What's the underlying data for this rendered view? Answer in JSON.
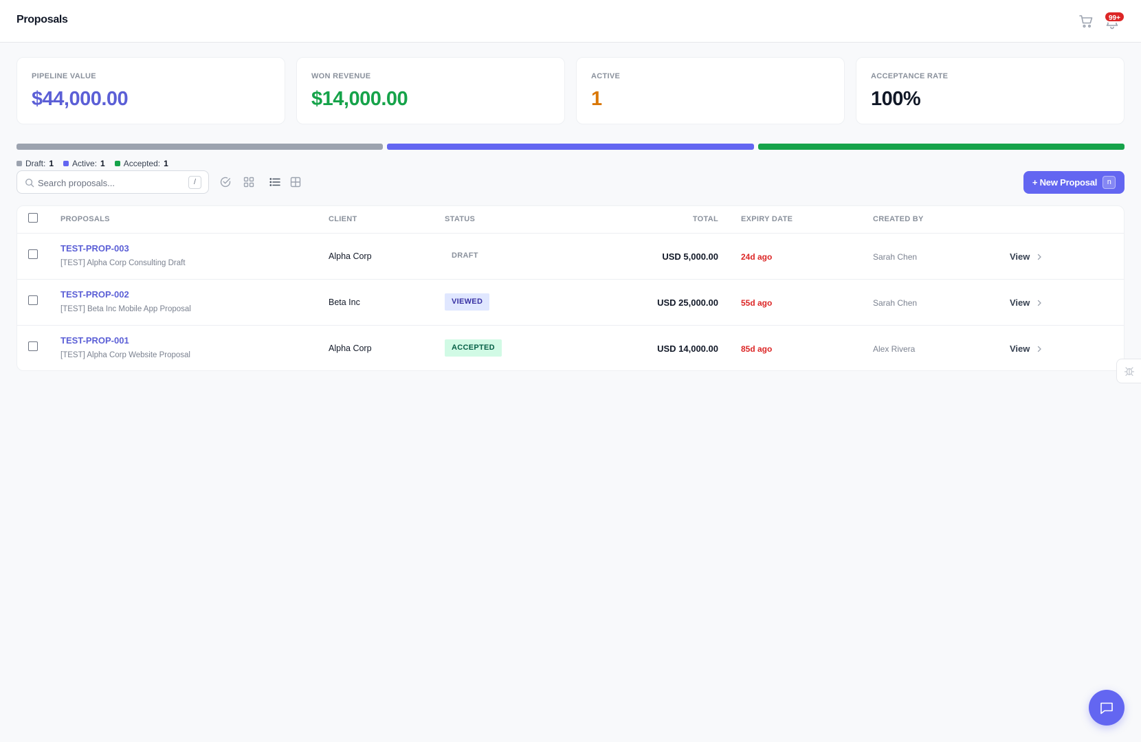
{
  "header": {
    "title": "Proposals",
    "notification_count": "99+"
  },
  "stats": [
    {
      "label": "PIPELINE VALUE",
      "value": "$44,000.00",
      "color": "#5b5fd6"
    },
    {
      "label": "WON REVENUE",
      "value": "$14,000.00",
      "color": "#16a34a"
    },
    {
      "label": "ACTIVE",
      "value": "1",
      "color": "#d97706"
    },
    {
      "label": "ACCEPTANCE RATE",
      "value": "100%",
      "color": "#111827"
    }
  ],
  "progress": [
    {
      "name": "Draft",
      "fraction": 0.3333,
      "color": "#9ca3af"
    },
    {
      "name": "Active",
      "fraction": 0.3333,
      "color": "#6366f1"
    },
    {
      "name": "Accepted",
      "fraction": 0.3334,
      "color": "#16a34a"
    }
  ],
  "legend": [
    {
      "label": "Draft:",
      "count": "1",
      "color": "#9ca3af"
    },
    {
      "label": "Active:",
      "count": "1",
      "color": "#6366f1"
    },
    {
      "label": "Accepted:",
      "count": "1",
      "color": "#16a34a"
    }
  ],
  "search": {
    "placeholder": "Search proposals...",
    "shortcut": "/"
  },
  "toolbar": {
    "new_label": "+ New Proposal",
    "new_shortcut": "n"
  },
  "table": {
    "headers": {
      "proposals": "PROPOSALS",
      "client": "CLIENT",
      "status": "STATUS",
      "total": "TOTAL",
      "expiry": "EXPIRY DATE",
      "created_by": "CREATED BY"
    },
    "rows": [
      {
        "id": "TEST-PROP-003",
        "name": "[TEST] Alpha Corp Consulting Draft",
        "client": "Alpha Corp",
        "status": "DRAFT",
        "status_bg": "#ffffff",
        "status_fg": "#8a919c",
        "total": "USD 5,000.00",
        "expiry": "24d ago",
        "created_by": "Sarah Chen",
        "action": "View"
      },
      {
        "id": "TEST-PROP-002",
        "name": "[TEST] Beta Inc Mobile App Proposal",
        "client": "Beta Inc",
        "status": "VIEWED",
        "status_bg": "#e0e7ff",
        "status_fg": "#3730a3",
        "total": "USD 25,000.00",
        "expiry": "55d ago",
        "created_by": "Sarah Chen",
        "action": "View"
      },
      {
        "id": "TEST-PROP-001",
        "name": "[TEST] Alpha Corp Website Proposal",
        "client": "Alpha Corp",
        "status": "ACCEPTED",
        "status_bg": "#d1fae5",
        "status_fg": "#065f46",
        "total": "USD 14,000.00",
        "expiry": "85d ago",
        "created_by": "Alex Rivera",
        "action": "View"
      }
    ]
  }
}
